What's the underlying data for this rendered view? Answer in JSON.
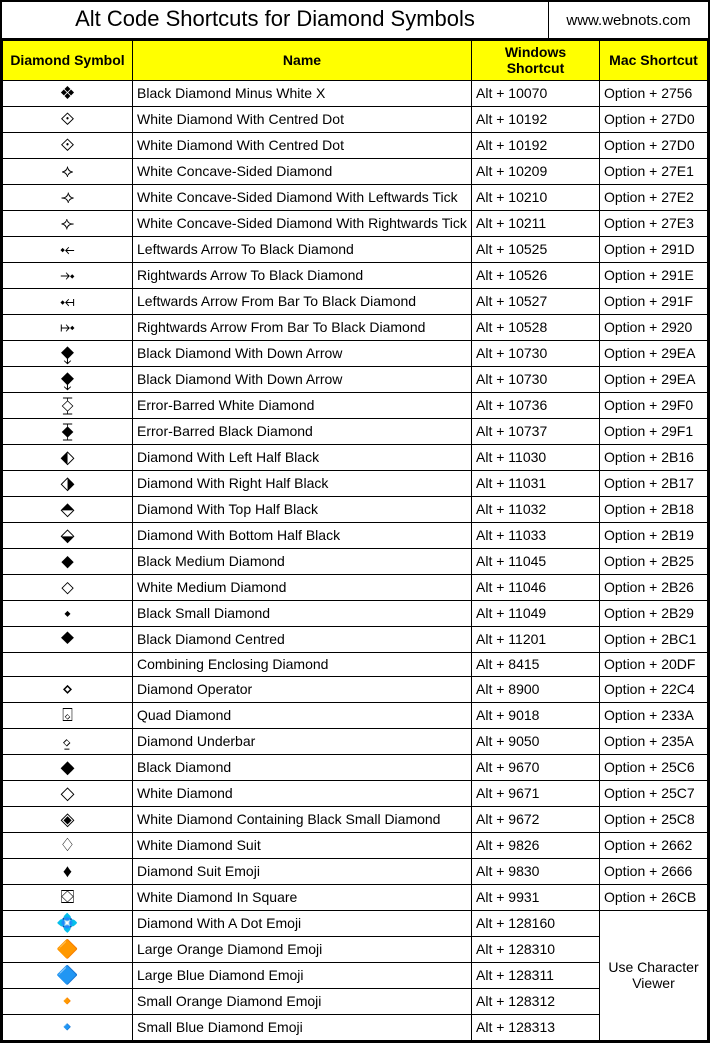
{
  "header": {
    "title": "Alt Code Shortcuts for Diamond Symbols",
    "site": "www.webnots.com"
  },
  "columns": {
    "symbol": "Diamond Symbol",
    "name": "Name",
    "win": "Windows Shortcut",
    "mac": "Mac Shortcut"
  },
  "merged_mac_label": "Use Character Viewer",
  "rows": [
    {
      "sym": "❖",
      "name": "Black Diamond Minus White X",
      "win": "Alt + 10070",
      "mac": "Option + 2756"
    },
    {
      "sym": "⟐",
      "name": "White Diamond With Centred Dot",
      "win": "Alt + 10192",
      "mac": "Option + 27D0"
    },
    {
      "sym": "⟐",
      "name": "White Diamond With Centred Dot",
      "win": "Alt + 10192",
      "mac": "Option + 27D0"
    },
    {
      "sym": "⟡",
      "name": "White Concave-Sided Diamond",
      "win": "Alt + 10209",
      "mac": "Option + 27E1"
    },
    {
      "sym": "⟢",
      "name": "White Concave-Sided Diamond With Leftwards Tick",
      "win": "Alt + 10210",
      "mac": "Option + 27E2"
    },
    {
      "sym": "⟣",
      "name": "White Concave-Sided Diamond With Rightwards Tick",
      "win": "Alt + 10211",
      "mac": "Option + 27E3"
    },
    {
      "sym": "⤝",
      "name": "Leftwards Arrow To Black Diamond",
      "win": "Alt + 10525",
      "mac": "Option + 291D"
    },
    {
      "sym": "⤞",
      "name": "Rightwards Arrow To Black Diamond",
      "win": "Alt + 10526",
      "mac": "Option + 291E"
    },
    {
      "sym": "⤟",
      "name": "Leftwards Arrow From Bar To Black Diamond",
      "win": "Alt + 10527",
      "mac": "Option + 291F"
    },
    {
      "sym": "⤠",
      "name": "Rightwards Arrow From Bar To Black Diamond",
      "win": "Alt + 10528",
      "mac": "Option + 2920"
    },
    {
      "sym": "⧪",
      "name": "Black Diamond With Down Arrow",
      "win": "Alt + 10730",
      "mac": "Option + 29EA"
    },
    {
      "sym": "⧪",
      "name": "Black Diamond With Down Arrow",
      "win": "Alt + 10730",
      "mac": "Option + 29EA"
    },
    {
      "sym": "⧰",
      "name": "Error-Barred White Diamond",
      "win": "Alt + 10736",
      "mac": "Option + 29F0"
    },
    {
      "sym": "⧱",
      "name": "Error-Barred Black Diamond",
      "win": "Alt + 10737",
      "mac": "Option + 29F1"
    },
    {
      "sym": "⬖",
      "name": "Diamond With Left Half Black",
      "win": "Alt + 11030",
      "mac": "Option + 2B16"
    },
    {
      "sym": "⬗",
      "name": "Diamond With Right Half Black",
      "win": "Alt + 11031",
      "mac": "Option + 2B17"
    },
    {
      "sym": "⬘",
      "name": "Diamond With Top Half Black",
      "win": "Alt + 11032",
      "mac": "Option + 2B18"
    },
    {
      "sym": "⬙",
      "name": "Diamond With Bottom Half Black",
      "win": "Alt + 11033",
      "mac": "Option + 2B19"
    },
    {
      "sym": "⬥",
      "name": "Black Medium Diamond",
      "win": "Alt + 11045",
      "mac": "Option + 2B25"
    },
    {
      "sym": "⬦",
      "name": "White Medium Diamond",
      "win": "Alt + 11046",
      "mac": "Option + 2B26"
    },
    {
      "sym": "⬩",
      "name": "Black Small Diamond",
      "win": "Alt + 11049",
      "mac": "Option + 2B29"
    },
    {
      "sym": "⯁",
      "name": "Black Diamond Centred",
      "win": "Alt + 11201",
      "mac": "Option + 2BC1"
    },
    {
      "sym": "",
      "name": "Combining Enclosing Diamond",
      "win": "Alt + 8415",
      "mac": "Option + 20DF"
    },
    {
      "sym": "⋄",
      "name": "Diamond Operator",
      "win": "Alt + 8900",
      "mac": "Option + 22C4"
    },
    {
      "sym": "⌺",
      "name": "Quad Diamond",
      "win": "Alt + 9018",
      "mac": "Option + 233A"
    },
    {
      "sym": "⍚",
      "name": "Diamond Underbar",
      "win": "Alt + 9050",
      "mac": "Option + 235A"
    },
    {
      "sym": "◆",
      "name": "Black Diamond",
      "win": "Alt + 9670",
      "mac": "Option + 25C6"
    },
    {
      "sym": "◇",
      "name": "White Diamond",
      "win": "Alt + 9671",
      "mac": "Option + 25C7"
    },
    {
      "sym": "◈",
      "name": "White Diamond Containing Black Small Diamond",
      "win": "Alt + 9672",
      "mac": "Option + 25C8"
    },
    {
      "sym": "♢",
      "name": "White Diamond Suit",
      "win": "Alt + 9826",
      "mac": "Option + 2662"
    },
    {
      "sym": "♦",
      "name": "Diamond Suit Emoji",
      "win": "Alt + 9830",
      "mac": "Option + 2666"
    },
    {
      "sym": "⛋",
      "name": "White Diamond In Square",
      "win": "Alt + 9931",
      "mac": "Option + 26CB"
    },
    {
      "sym": "💠",
      "name": "Diamond With A Dot Emoji",
      "win": "Alt + 128160",
      "mac": null
    },
    {
      "sym": "🔶",
      "name": "Large Orange Diamond Emoji",
      "win": "Alt + 128310",
      "mac": null
    },
    {
      "sym": "🔷",
      "name": "Large Blue Diamond Emoji",
      "win": "Alt + 128311",
      "mac": null
    },
    {
      "sym": "🔸",
      "name": "Small Orange Diamond Emoji",
      "win": "Alt + 128312",
      "mac": null
    },
    {
      "sym": "🔹",
      "name": "Small Blue Diamond Emoji",
      "win": "Alt + 128313",
      "mac": null
    }
  ]
}
